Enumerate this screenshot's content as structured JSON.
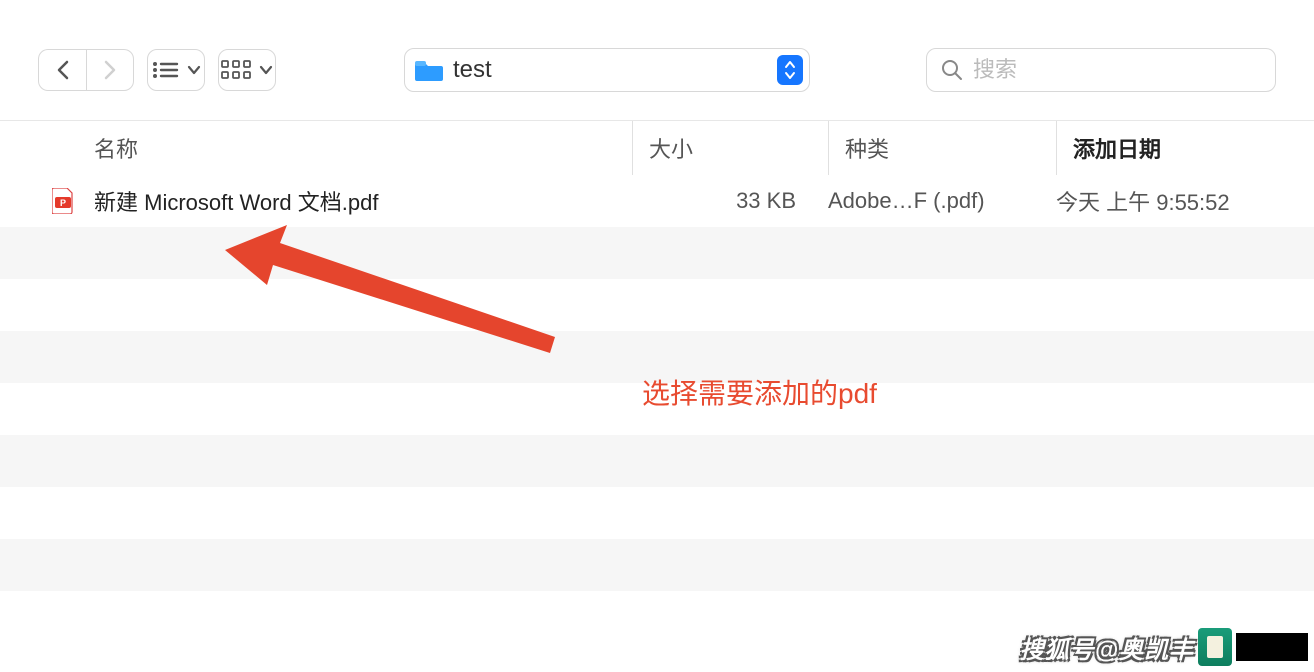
{
  "toolbar": {
    "location": "test",
    "search_placeholder": "搜索"
  },
  "columns": {
    "name": "名称",
    "size": "大小",
    "kind": "种类",
    "date_added": "添加日期"
  },
  "files": [
    {
      "name": "新建 Microsoft Word 文档.pdf",
      "size": "33 KB",
      "kind": "Adobe…F (.pdf)",
      "date_added": "今天 上午 9:55:52"
    }
  ],
  "annotation": {
    "text": "选择需要添加的pdf"
  },
  "watermark": {
    "text": "搜狐号@奥凯丰"
  }
}
